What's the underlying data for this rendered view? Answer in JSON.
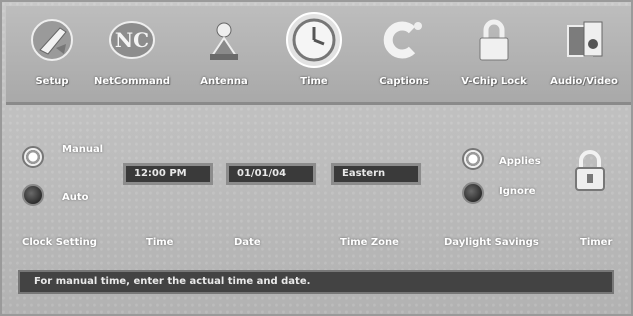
{
  "toolbar": {
    "items": [
      {
        "label": "Setup",
        "icon": "setup-icon"
      },
      {
        "label": "NetCommand",
        "icon": "netcommand-icon"
      },
      {
        "label": "Antenna",
        "icon": "antenna-icon"
      },
      {
        "label": "Time",
        "icon": "clock-icon",
        "selected": true
      },
      {
        "label": "Captions",
        "icon": "captions-icon"
      },
      {
        "label": "V-Chip Lock",
        "icon": "lock-icon"
      },
      {
        "label": "Audio/Video",
        "icon": "audio-video-icon"
      }
    ]
  },
  "clock_setting": {
    "manual_label": "Manual",
    "auto_label": "Auto",
    "selected": "Manual",
    "caption": "Clock Setting"
  },
  "time": {
    "value": "12:00 PM",
    "caption": "Time"
  },
  "date": {
    "value": "01/01/04",
    "caption": "Date"
  },
  "time_zone": {
    "value": "Eastern",
    "caption": "Time Zone"
  },
  "daylight_savings": {
    "applies_label": "Applies",
    "ignore_label": "Ignore",
    "selected": "Applies",
    "caption": "Daylight Savings"
  },
  "timer": {
    "caption": "Timer",
    "icon": "padlock-icon"
  },
  "status": {
    "message": "For manual time, enter the actual time and date."
  }
}
